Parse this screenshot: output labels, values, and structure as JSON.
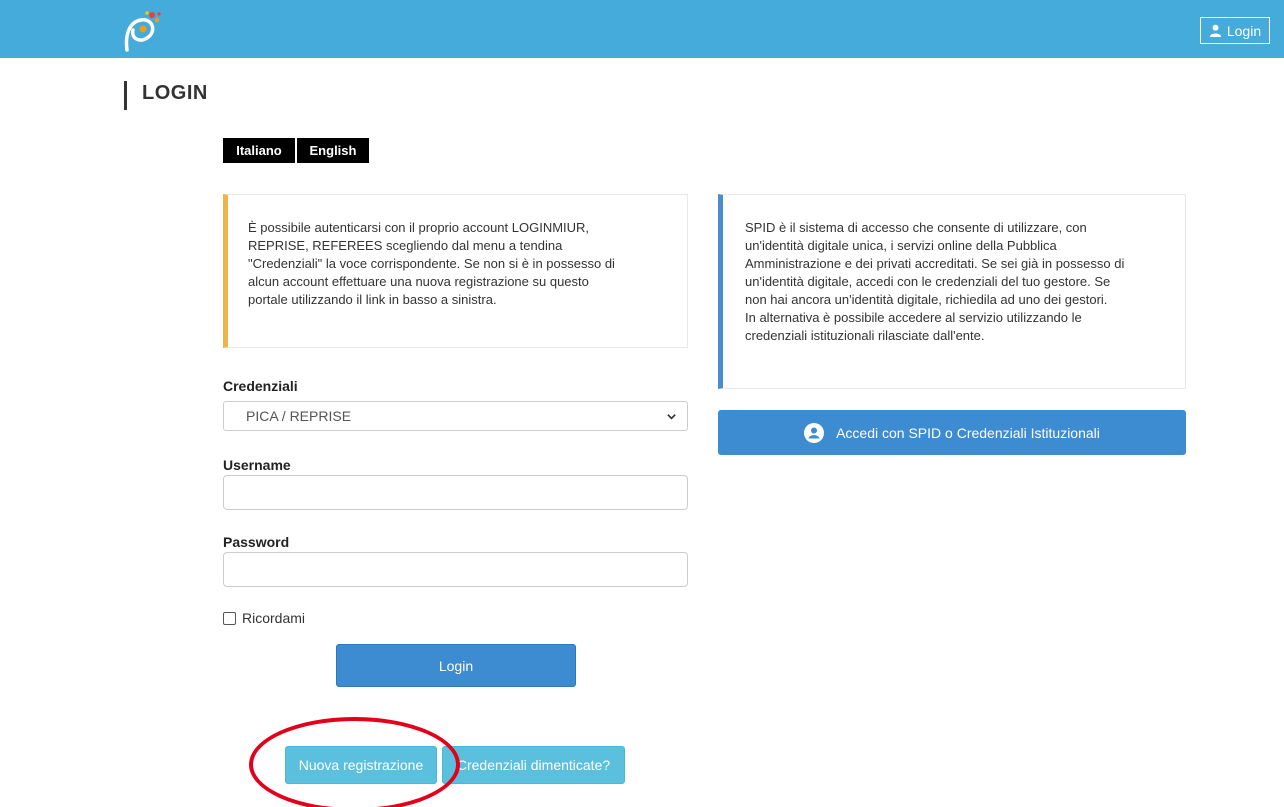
{
  "header": {
    "logo_icon": "pica-logo-icon",
    "login_label": "Login",
    "login_icon": "user-icon",
    "bg_color": "#45abda"
  },
  "page": {
    "title": "LOGIN"
  },
  "languages": [
    {
      "label": "Italiano"
    },
    {
      "label": "English"
    }
  ],
  "info_left": {
    "lines": [
      "È possibile autenticarsi con il proprio account LOGINMIUR,",
      "REPRISE, REFEREES scegliendo dal menu a tendina",
      "\"Credenziali\" la voce corrispondente. Se non si è in possesso di",
      "alcun account effettuare una nuova registrazione su questo",
      "portale utilizzando il link in basso a sinistra."
    ],
    "accent": "#f0b34a"
  },
  "info_right": {
    "lines": [
      "SPID è il sistema di accesso che consente di utilizzare, con",
      "un'identità digitale unica, i servizi online della Pubblica",
      "Amministrazione e dei privati accreditati. Se sei già in possesso di",
      "un'identità digitale, accedi con le credenziali del tuo gestore. Se",
      "non hai ancora un'identità digitale, richiedila ad uno dei gestori.",
      "In alternativa è possibile accedere al servizio utilizzando le",
      "credenziali istituzionali rilasciate dall'ente."
    ],
    "accent": "#4a8ccc"
  },
  "form": {
    "credentials_label": "Credenziali",
    "credentials_value": "PICA / REPRISE",
    "username_label": "Username",
    "username_value": "",
    "password_label": "Password",
    "password_value": "",
    "remember_label": "Ricordami",
    "remember_checked": false,
    "login_button": "Login"
  },
  "spid_button": {
    "label": "Accedi con SPID o Credenziali Istituzionali",
    "icon": "spid-user-icon"
  },
  "footer_buttons": {
    "register": "Nuova registrazione",
    "forgot": "Credenziali dimenticate?"
  },
  "annotation": {
    "color": "#e3001b"
  }
}
